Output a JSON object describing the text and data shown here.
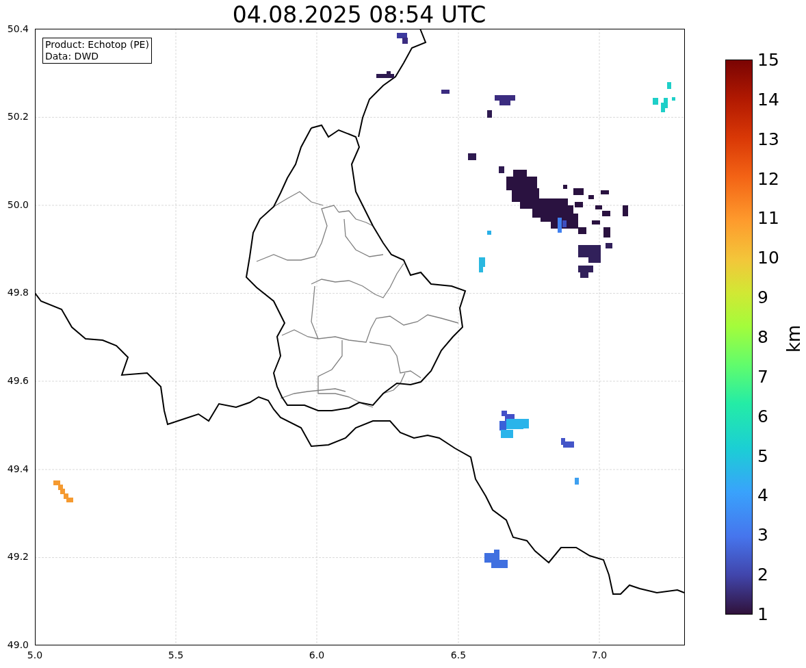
{
  "title": "04.08.2025 08:54 UTC",
  "info_box": [
    "Product: Echotop (PE)",
    "Data: DWD"
  ],
  "map": {
    "x_ticks": [
      "5.0",
      "5.5",
      "6.0",
      "6.5",
      "7.0"
    ],
    "y_ticks": [
      "50.4",
      "50.2",
      "50.0",
      "49.8",
      "49.6",
      "49.4",
      "49.2",
      "49.0"
    ]
  },
  "colorbar": {
    "label": "km",
    "ticks": [
      "15",
      "14",
      "13",
      "12",
      "11",
      "10",
      "9",
      "8",
      "7",
      "6",
      "5",
      "4",
      "3",
      "2",
      "1"
    ]
  }
}
